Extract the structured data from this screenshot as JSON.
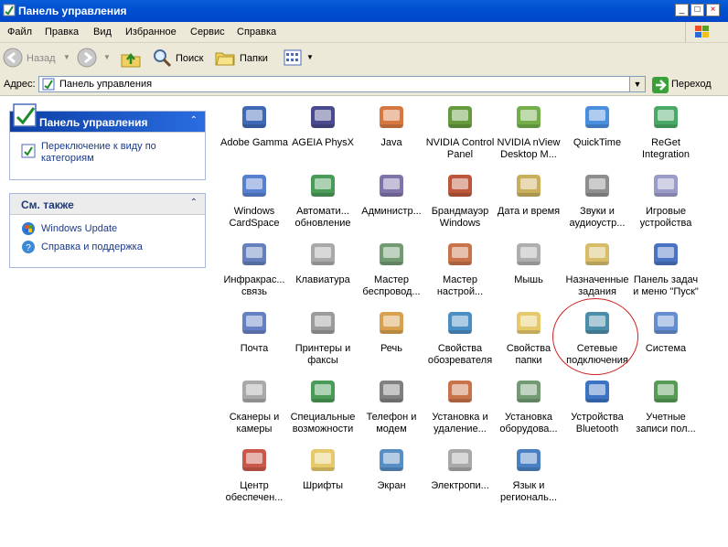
{
  "window": {
    "title": "Панель управления",
    "buttons": [
      "_",
      "□",
      "×"
    ]
  },
  "menu": [
    "Файл",
    "Правка",
    "Вид",
    "Избранное",
    "Сервис",
    "Справка"
  ],
  "toolbar": {
    "back": "Назад",
    "search": "Поиск",
    "folders": "Папки"
  },
  "address": {
    "label": "Адрес:",
    "value": "Панель управления",
    "go": "Переход"
  },
  "left_panel": {
    "cp_title": "Панель управления",
    "switch_view": "Переключение к виду по категориям",
    "see_also_title": "См. также",
    "windows_update": "Windows Update",
    "help": "Справка и поддержка"
  },
  "items": [
    {
      "label": "Adobe Gamma",
      "icon": "monitor-gamma-icon",
      "color": "#1f4fa8"
    },
    {
      "label": "AGEIA PhysX",
      "icon": "ageia-icon",
      "color": "#2a2a7a"
    },
    {
      "label": "Java",
      "icon": "java-icon",
      "color": "#d06020"
    },
    {
      "label": "NVIDIA Control Panel",
      "icon": "nvidia-icon",
      "color": "#4a8a1a"
    },
    {
      "label": "NVIDIA nView Desktop M...",
      "icon": "nvidia-nview-icon",
      "color": "#5aa02a"
    },
    {
      "label": "QuickTime",
      "icon": "quicktime-icon",
      "color": "#2a7ad8"
    },
    {
      "label": "ReGet Integration",
      "icon": "reget-icon",
      "color": "#2a9a4a"
    },
    {
      "label": "Windows CardSpace",
      "icon": "cardspace-icon",
      "color": "#3a6ac8"
    },
    {
      "label": "Автомати... обновление",
      "icon": "windows-update-icon",
      "color": "#2a8a3a"
    },
    {
      "label": "Администр...",
      "icon": "admin-tools-icon",
      "color": "#6a5a9a"
    },
    {
      "label": "Брандмауэр Windows",
      "icon": "firewall-icon",
      "color": "#b03a1a"
    },
    {
      "label": "Дата и время",
      "icon": "datetime-icon",
      "color": "#c0a040"
    },
    {
      "label": "Звуки и аудиоустр...",
      "icon": "sounds-icon",
      "color": "#7a7a7a"
    },
    {
      "label": "Игровые устройства",
      "icon": "gamepad-icon",
      "color": "#8a8ac0"
    },
    {
      "label": "Инфракрас... связь",
      "icon": "infrared-icon",
      "color": "#4a6ab0"
    },
    {
      "label": "Клавиатура",
      "icon": "keyboard-icon",
      "color": "#9a9a9a"
    },
    {
      "label": "Мастер беспровод...",
      "icon": "wireless-icon",
      "color": "#5a8a5a"
    },
    {
      "label": "Мастер настрой...",
      "icon": "network-setup-icon",
      "color": "#c05a2a"
    },
    {
      "label": "Мышь",
      "icon": "mouse-icon",
      "color": "#a0a0a0"
    },
    {
      "label": "Назначенные задания",
      "icon": "scheduled-tasks-icon",
      "color": "#d0b050"
    },
    {
      "label": "Панель задач и меню \"Пуск\"",
      "icon": "taskbar-icon",
      "color": "#2a5ab8"
    },
    {
      "label": "Почта",
      "icon": "mail-icon",
      "color": "#4a6ab8"
    },
    {
      "label": "Принтеры и факсы",
      "icon": "printer-icon",
      "color": "#8a8a8a"
    },
    {
      "label": "Речь",
      "icon": "speech-icon",
      "color": "#d09030"
    },
    {
      "label": "Свойства обозревателя",
      "icon": "internet-options-icon",
      "color": "#2a7ab8"
    },
    {
      "label": "Свойства папки",
      "icon": "folder-options-icon",
      "color": "#e0c050"
    },
    {
      "label": "Сетевые подключения",
      "icon": "network-connections-icon",
      "color": "#2a7a9a"
    },
    {
      "label": "Система",
      "icon": "system-icon",
      "color": "#4a7ac8"
    },
    {
      "label": "Сканеры и камеры",
      "icon": "scanner-icon",
      "color": "#9a9a9a"
    },
    {
      "label": "Специальные возможности",
      "icon": "accessibility-icon",
      "color": "#2a8a3a"
    },
    {
      "label": "Телефон и модем",
      "icon": "phone-modem-icon",
      "color": "#6a6a6a"
    },
    {
      "label": "Установка и удаление...",
      "icon": "add-remove-icon",
      "color": "#c05a2a"
    },
    {
      "label": "Установка оборудова...",
      "icon": "add-hardware-icon",
      "color": "#5a8a5a"
    },
    {
      "label": "Устройства Bluetooth",
      "icon": "bluetooth-icon",
      "color": "#1a5ab8"
    },
    {
      "label": "Учетные записи пол...",
      "icon": "user-accounts-icon",
      "color": "#3a8a3a"
    },
    {
      "label": "Центр обеспечен...",
      "icon": "security-center-icon",
      "color": "#c03a2a"
    },
    {
      "label": "Шрифты",
      "icon": "fonts-icon",
      "color": "#e0c050"
    },
    {
      "label": "Экран",
      "icon": "display-icon",
      "color": "#3a7ab8"
    },
    {
      "label": "Электропи...",
      "icon": "power-options-icon",
      "color": "#9a9a9a"
    },
    {
      "label": "Язык и региональ...",
      "icon": "regional-icon",
      "color": "#2a6ab8"
    }
  ]
}
